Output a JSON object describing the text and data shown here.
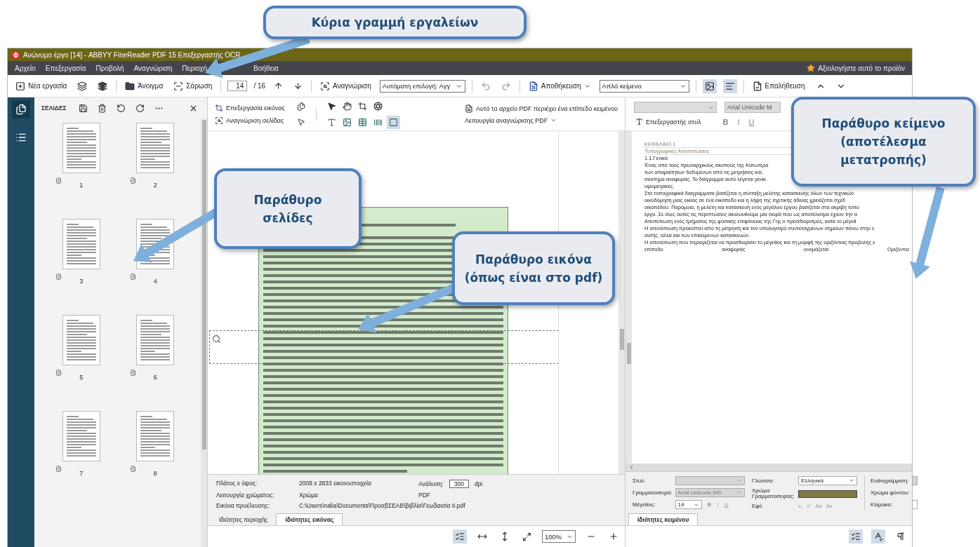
{
  "window": {
    "title": "Ανώνυμο έργο [14] - ABBYY FineReader PDF 15 Επεξεργαστής OCR"
  },
  "menu": {
    "items": [
      "Αρχείο",
      "Επεξεργασία",
      "Προβολή",
      "Αναγνώριση",
      "Περιοχή",
      "Βοήθεια"
    ],
    "rate": "Αξιολογήστε αυτό το προϊόν"
  },
  "toolbar": {
    "new_task": "Νέα εργασία",
    "open": "Άνοιγμα",
    "scan": "Σάρωση",
    "page": "14",
    "page_count": "/ 16",
    "recognize": "Αναγνώριση",
    "language": "Αυτόματη επιλογή: Αγγ",
    "save": "Αποθήκευση",
    "save_format": "Απλό κείμενο",
    "verify": "Επαλήθευση",
    "views": [
      {
        "kind": "image",
        "selected": true
      },
      {
        "kind": "text",
        "selected": true
      }
    ]
  },
  "pages_panel": {
    "title": "ΣΕΛΙΔΕΣ",
    "pages": [
      "1",
      "2",
      "3",
      "4",
      "5",
      "6",
      "7",
      "8"
    ]
  },
  "image_pane": {
    "edit_image": "Επεξεργασία εικόνας",
    "recognize_page": "Αναγνώριση σελίδας",
    "pdf_note": "Αυτό το αρχείο PDF περιέχει ένα επίπεδο κειμένου",
    "pdf_mode": "Λειτουργία αναγνώρισης PDF",
    "area_tools": [
      {
        "kind": "text",
        "selected": false
      },
      {
        "kind": "picture",
        "selected": false
      },
      {
        "kind": "table",
        "selected": false
      },
      {
        "kind": "barcode",
        "selected": false
      },
      {
        "kind": "background",
        "selected": true
      }
    ],
    "properties": {
      "size_label": "Πλάτος x ύψος:",
      "size": "2008 x 2833 εικονοστοιχεία",
      "resolution_label": "Ανάλυση:",
      "resolution": "300",
      "unit": "dpi",
      "color_label": "Λειτουργία χρώματος:",
      "color_mode": "Χρώμα",
      "format": "PDF",
      "source_label": "Εικόνα προέλευσης:",
      "source": "C:\\Users\\nalia\\Documents\\ΠροσβΣΕΑΒ\\βιβλία\\Γεωδαισία ΙΙ.pdf"
    },
    "tabs": [
      {
        "label": "Ιδιότητες περιοχής",
        "selected": false
      },
      {
        "label": "Ιδιότητες εικόνας",
        "selected": true
      }
    ],
    "zoom": "100%"
  },
  "text_pane": {
    "font": "Arial Unicode M",
    "style_editor": "Επεξεργαστής στυλ",
    "format": [
      "B",
      "I",
      "U"
    ],
    "lines": [
      {
        "kind": "caption",
        "text": "ΚΕΦΑΛΑΙΟ 1"
      },
      {
        "kind": "caption",
        "text": "Τοπογραφικές Αποτυπώσεις"
      },
      {
        "kind": "body",
        "text": "1.1.Γενικά"
      },
      {
        "kind": "body",
        "text": "Ένας από τους πρωταρχικούς σκοπούς της Κατωτέρα"
      },
      {
        "kind": "body",
        "text": "των απαραίτητων δεδομένων από τις μετρήσεις και,"
      },
      {
        "kind": "body",
        "text": "σύστημα αναφοράς. Το διάγραμμα αυτό λέγεται γενικ"
      },
      {
        "kind": "body",
        "text": "υψομετρικές."
      },
      {
        "kind": "body",
        "text": "Στα τοπογραφικά διαγράμματα βασίζεται η σύνταξη μελέτης κατασκευής όλων των τεχνικών"
      },
      {
        "kind": "body",
        "text": "οικοδόμηση μιας οικίας σε ένα οικόπεδο και η λήψη της σχετικής άδειας χρειάζεται σχέδ"
      },
      {
        "kind": "body",
        "text": "οικοπέδου. Παρόμοια, η μελέτη και κατασκευή ενός μεγάλου έργου βασίζεται στα ακριβή τοπο"
      },
      {
        "kind": "body",
        "text": "έργο. Σε όλες αυτές τις περιπτώσεις ακολουθούμε μία σειρά που ως αποτέλεσμα έχουν την α"
      },
      {
        "kind": "body",
        "text": "Αποτύπωση ενός τμήματος της φυσικής επιφάνειας της Γης ο προσδιορισμός, κατά το μέγεθ"
      },
      {
        "kind": "body",
        "text": "Η αποτύπωση προκύπτει από τη μέτρηση και τον υπολογισμό συντεταγμένων σημείων πάνω στην ε"
      },
      {
        "kind": "body",
        "text": "αυτής, αλλά και των επικείμενων κατασκευών."
      },
      {
        "kind": "body",
        "text": "Η αποτύπωση που περιορίζεται να προσδιορίσει το μέγεθος και τη μορφή της οριζόντιας προβολής ε"
      },
      {
        "kind": "spread",
        "text": "επίπεδο αναφοράς ονομάζεται Οριζόντια"
      }
    ],
    "properties": {
      "style_label": "Στυλ:",
      "font_label": "Γραμματοσειρά:",
      "font": "Arial Unicode MS",
      "size_label": "Μέγεθος:",
      "size": "14",
      "format": [
        "B",
        "I",
        "U"
      ],
      "language_label": "Γλώσσα:",
      "language": "Ελληνικά",
      "color_label": "Χρώμα Γραμματοσειράς:",
      "effects_label": "Εφέ:",
      "effects": [
        "x₁",
        "x¹",
        "Aa",
        "Aᴀ"
      ],
      "align_label": "Ευθυγράμμιση:",
      "background_label": "Χρώμα φόντου:",
      "scale_label": "Κλίμακα:"
    },
    "tab": {
      "label": "Ιδιότητες κειμένου",
      "selected": true
    }
  },
  "callouts": [
    {
      "lines": [
        "Κύρια γραμμή εργαλείων"
      ]
    },
    {
      "lines": [
        "Παράθυρο",
        "σελίδες"
      ]
    },
    {
      "lines": [
        "Παράθυρο εικόνα",
        "(όπως είναι στο pdf)"
      ]
    },
    {
      "lines": [
        "Παράθυρο κείμενο",
        "(αποτέλεσμα",
        "μετατροπής)"
      ]
    }
  ]
}
